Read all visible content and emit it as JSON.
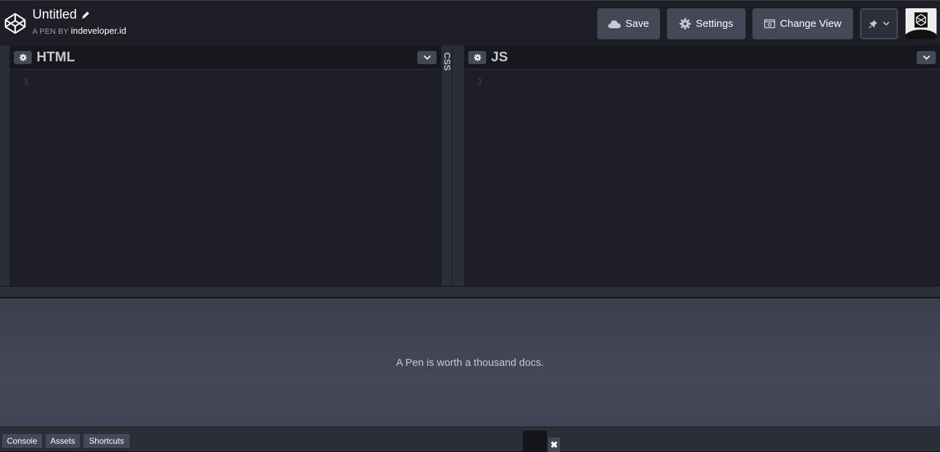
{
  "header": {
    "title": "Untitled",
    "byline_prefix": "A PEN BY",
    "author": "indeveloper.id",
    "buttons": {
      "save": "Save",
      "settings": "Settings",
      "change_view": "Change View"
    }
  },
  "editors": {
    "html": {
      "title": "HTML",
      "line_number": "1"
    },
    "css": {
      "title": "CSS"
    },
    "js": {
      "title": "JS",
      "line_number": "1"
    }
  },
  "preview": {
    "placeholder": "A Pen is worth a thousand docs."
  },
  "footer": {
    "buttons": [
      "Console",
      "Assets",
      "Shortcuts"
    ],
    "close_glyph": "✖"
  },
  "colors": {
    "header_bg": "#1e1f26",
    "button_bg": "#444857",
    "editor_bg": "#1e1f26",
    "preview_bg": "#414452"
  }
}
